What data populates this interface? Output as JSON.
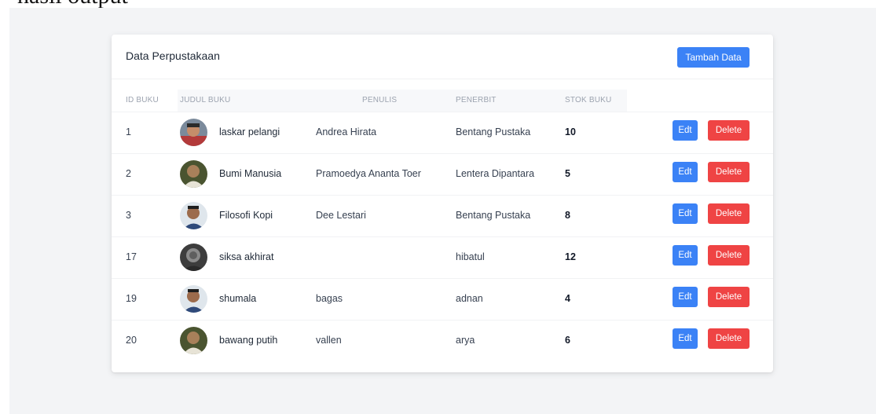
{
  "top_text": "hasil output",
  "card": {
    "title": "Data Perpustakaan",
    "add_button": "Tambah Data"
  },
  "table": {
    "headers": {
      "id": "ID BUKU",
      "title": "JUDUL BUKU",
      "author": "PENULIS",
      "publisher": "PENERBIT",
      "stock": "STOK BUKU"
    },
    "rows": [
      {
        "id": "1",
        "title": "laskar pelangi",
        "author": "Andrea Hirata",
        "publisher": "Bentang Pustaka",
        "stock": "10",
        "edit": "Edt",
        "delete": "Delete"
      },
      {
        "id": "2",
        "title": "Bumi Manusia",
        "author": "Pramoedya Ananta Toer",
        "publisher": "Lentera Dipantara",
        "stock": "5",
        "edit": "Edt",
        "delete": "Delete"
      },
      {
        "id": "3",
        "title": "Filosofi Kopi",
        "author": "Dee Lestari",
        "publisher": "Bentang Pustaka",
        "stock": "8",
        "edit": "Edt",
        "delete": "Delete"
      },
      {
        "id": "17",
        "title": "siksa akhirat",
        "author": "",
        "publisher": "hibatul",
        "stock": "12",
        "edit": "Edt",
        "delete": "Delete"
      },
      {
        "id": "19",
        "title": "shumala",
        "author": "bagas",
        "publisher": "adnan",
        "stock": "4",
        "edit": "Edt",
        "delete": "Delete"
      },
      {
        "id": "20",
        "title": "bawang putih",
        "author": "vallen",
        "publisher": "arya",
        "stock": "6",
        "edit": "Edt",
        "delete": "Delete"
      }
    ]
  },
  "colors": {
    "primary": "#3b82f6",
    "danger": "#ef4444",
    "page_background": "#f3f4f6"
  }
}
